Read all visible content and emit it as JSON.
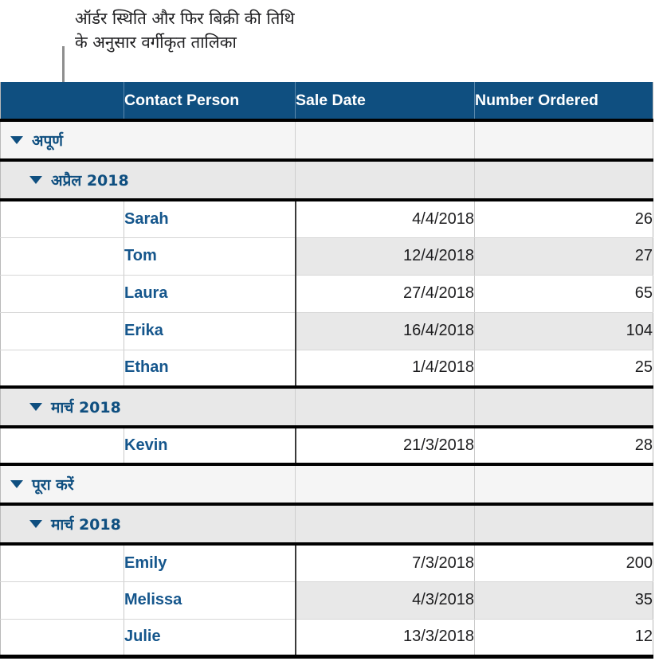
{
  "caption": {
    "line1": "ऑर्डर स्थिति और फिर बिक्री की तिथि",
    "line2": "के अनुसार वर्गीकृत तालिका"
  },
  "colors": {
    "header_background": "#0f4f80",
    "header_text": "#ffffff",
    "group_text": "#0f4f80",
    "name_text": "#15568c",
    "level1_group_background": "#f5f5f5",
    "level2_group_background": "#e8e8e8",
    "stripe_background": "#e8e8e8",
    "leader_line": "#8e8e8e"
  },
  "table": {
    "columns": [
      {
        "key": "index",
        "label": ""
      },
      {
        "key": "name",
        "label": "Contact Person"
      },
      {
        "key": "date",
        "label": "Sale Date"
      },
      {
        "key": "number",
        "label": "Number Ordered"
      }
    ],
    "disclosure_icon": "triangle-down-icon",
    "rows": [
      {
        "kind": "group",
        "level": 1,
        "label": "अपूर्ण"
      },
      {
        "kind": "group",
        "level": 2,
        "label": "अप्रैल 2018"
      },
      {
        "kind": "data",
        "name": "Sarah",
        "date": "4/4/2018",
        "number": "26",
        "striped": false,
        "last_in_group": false
      },
      {
        "kind": "data",
        "name": "Tom",
        "date": "12/4/2018",
        "number": "27",
        "striped": true,
        "last_in_group": false
      },
      {
        "kind": "data",
        "name": "Laura",
        "date": "27/4/2018",
        "number": "65",
        "striped": false,
        "last_in_group": false
      },
      {
        "kind": "data",
        "name": "Erika",
        "date": "16/4/2018",
        "number": "104",
        "striped": true,
        "last_in_group": false
      },
      {
        "kind": "data",
        "name": "Ethan",
        "date": "1/4/2018",
        "number": "25",
        "striped": false,
        "last_in_group": true
      },
      {
        "kind": "group",
        "level": 2,
        "label": "मार्च 2018"
      },
      {
        "kind": "data",
        "name": "Kevin",
        "date": "21/3/2018",
        "number": "28",
        "striped": false,
        "last_in_group": true
      },
      {
        "kind": "group",
        "level": 1,
        "label": "पूरा करें"
      },
      {
        "kind": "group",
        "level": 2,
        "label": "मार्च 2018"
      },
      {
        "kind": "data",
        "name": "Emily",
        "date": "7/3/2018",
        "number": "200",
        "striped": false,
        "last_in_group": false
      },
      {
        "kind": "data",
        "name": "Melissa",
        "date": "4/3/2018",
        "number": "35",
        "striped": true,
        "last_in_group": false
      },
      {
        "kind": "data",
        "name": "Julie",
        "date": "13/3/2018",
        "number": "12",
        "striped": false,
        "last_in_group": false,
        "table_last": true
      }
    ]
  }
}
